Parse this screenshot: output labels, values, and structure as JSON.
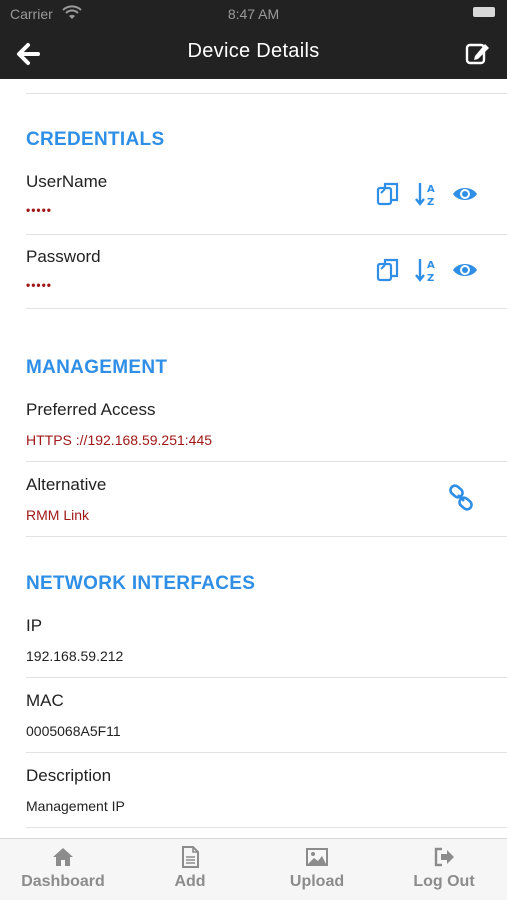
{
  "status": {
    "carrier": "Carrier",
    "time": "8:47 AM"
  },
  "header": {
    "title": "Device Details"
  },
  "credentials": {
    "title": "CREDENTIALS",
    "items": [
      {
        "label": "UserName",
        "value": "•••••"
      },
      {
        "label": "Password",
        "value": "•••••"
      }
    ]
  },
  "management": {
    "title": "MANAGEMENT",
    "preferred_label": "Preferred Access",
    "preferred_value": "HTTPS ://192.168.59.251:445",
    "alternative_label": "Alternative",
    "alternative_value": "RMM Link"
  },
  "network": {
    "title": "NETWORK INTERFACES",
    "ip_label": "IP",
    "ip_value": "192.168.59.212",
    "mac_label": "MAC",
    "mac_value": "0005068A5F11",
    "desc_label": "Description",
    "desc_value": "Management IP"
  },
  "tabs": [
    {
      "label": "Dashboard",
      "icon": "home-icon"
    },
    {
      "label": "Add",
      "icon": "document-icon"
    },
    {
      "label": "Upload",
      "icon": "image-icon"
    },
    {
      "label": "Log Out",
      "icon": "logout-icon"
    }
  ],
  "colors": {
    "accent": "#2f8fe6",
    "value_red": "#a01818",
    "header_bg": "#222222"
  }
}
